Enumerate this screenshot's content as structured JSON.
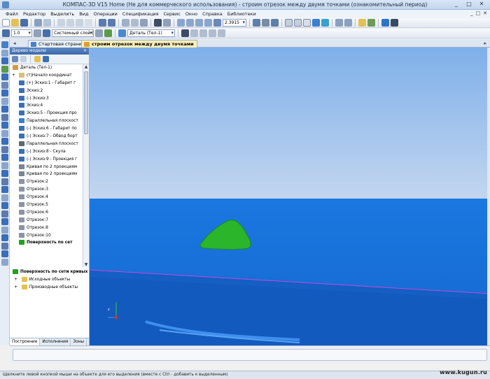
{
  "window": {
    "title": "КОМПАС-3D V15 Home (Не для коммерческого использования) - строим отрезок между двумя точками (ознакомительный период)",
    "controls": [
      "_",
      "□",
      "✕"
    ]
  },
  "menu": {
    "items": [
      "Файл",
      "Редактор",
      "Выделить",
      "Вид",
      "Операции",
      "Спецификация",
      "Сервис",
      "Окно",
      "Справка",
      "Библиотеки"
    ],
    "mdi_controls": [
      "_",
      "□",
      "✕"
    ]
  },
  "toolbar": {
    "scale_value": "1.0",
    "layer_value": "Системный слой (0)",
    "zoom_value": "2.3915",
    "part_value": "Деталь (Тел-1)"
  },
  "tabs": [
    {
      "label": "Стартовая страница",
      "active": false
    },
    {
      "label": "строим отрезок между двумя точками",
      "active": true
    }
  ],
  "tree": {
    "panel_title": "Дерево модели",
    "close_glyph": "×",
    "scroll_up": "▲",
    "scroll_down": "▼",
    "rows": [
      {
        "label": "Деталь (Тел-1)",
        "indent": 0,
        "icon": "#d89a3a"
      },
      {
        "label": "(т)Начало координат",
        "indent": 1,
        "icon": "#d8c07a",
        "expander": "+"
      },
      {
        "label": "(+) Эскиз:1 - Габарит г",
        "indent": 1,
        "icon": "#3d6fb8"
      },
      {
        "label": "Эскиз:2",
        "indent": 1,
        "icon": "#3d6fb8"
      },
      {
        "label": "(-) Эскиз:3",
        "indent": 1,
        "icon": "#3d6fb8"
      },
      {
        "label": "Эскиз:4",
        "indent": 1,
        "icon": "#3d6fb8"
      },
      {
        "label": "Эскиз:5 - Проекция про",
        "indent": 1,
        "icon": "#3d6fb8"
      },
      {
        "label": "Параллельная плоскост",
        "indent": 1,
        "icon": "#3a7fd0"
      },
      {
        "label": "(-) Эскиз:6 - Габарит по",
        "indent": 1,
        "icon": "#3d6fb8"
      },
      {
        "label": "(-) Эскиз:7 - Обвод борт",
        "indent": 1,
        "icon": "#3d6fb8"
      },
      {
        "label": "Параллельная плоскост",
        "indent": 1,
        "icon": "#606870"
      },
      {
        "label": "(-) Эскиз:8 - Скула",
        "indent": 1,
        "icon": "#3d6fb8"
      },
      {
        "label": "(-) Эскиз:9 - Проекция г",
        "indent": 1,
        "icon": "#3d6fb8"
      },
      {
        "label": "Кривая по 2 проекциям",
        "indent": 1,
        "icon": "#7a8494"
      },
      {
        "label": "Кривая по 2 проекциям",
        "indent": 1,
        "icon": "#7a8494"
      },
      {
        "label": "Отрезок:2",
        "indent": 1,
        "icon": "#8a94a4"
      },
      {
        "label": "Отрезок:3",
        "indent": 1,
        "icon": "#8a94a4"
      },
      {
        "label": "Отрезок:4",
        "indent": 1,
        "icon": "#8a94a4"
      },
      {
        "label": "Отрезок:5",
        "indent": 1,
        "icon": "#8a94a4"
      },
      {
        "label": "Отрезок:6",
        "indent": 1,
        "icon": "#8a94a4"
      },
      {
        "label": "Отрезок:7",
        "indent": 1,
        "icon": "#8a94a4"
      },
      {
        "label": "Отрезок:8",
        "indent": 1,
        "icon": "#8a94a4"
      },
      {
        "label": "Отрезок:10",
        "indent": 1,
        "icon": "#8a94a4"
      },
      {
        "label": "Поверхность по сет",
        "indent": 1,
        "icon": "#1fa31f",
        "bold": true
      }
    ],
    "bottom": {
      "title": "Поверхность по сети кривых",
      "items": [
        "Исходные объекты",
        "Производные объекты"
      ],
      "expander": "+"
    },
    "bottom_tabs": [
      "Построение",
      "Исполнения",
      "Зоны"
    ]
  },
  "viewport": {
    "triad_label": "z",
    "colors": {
      "sky_top": "#7fb0ea",
      "sky_bottom": "#c3d6ef",
      "ground": "#1f73db",
      "shape": "#2bb52b"
    }
  },
  "status": {
    "text": "Щелкните левой кнопкой мыши на объекте для его выделения (вместе с Ctrl - добавить к выделенным)",
    "watermark": "www.kugun.ru"
  }
}
